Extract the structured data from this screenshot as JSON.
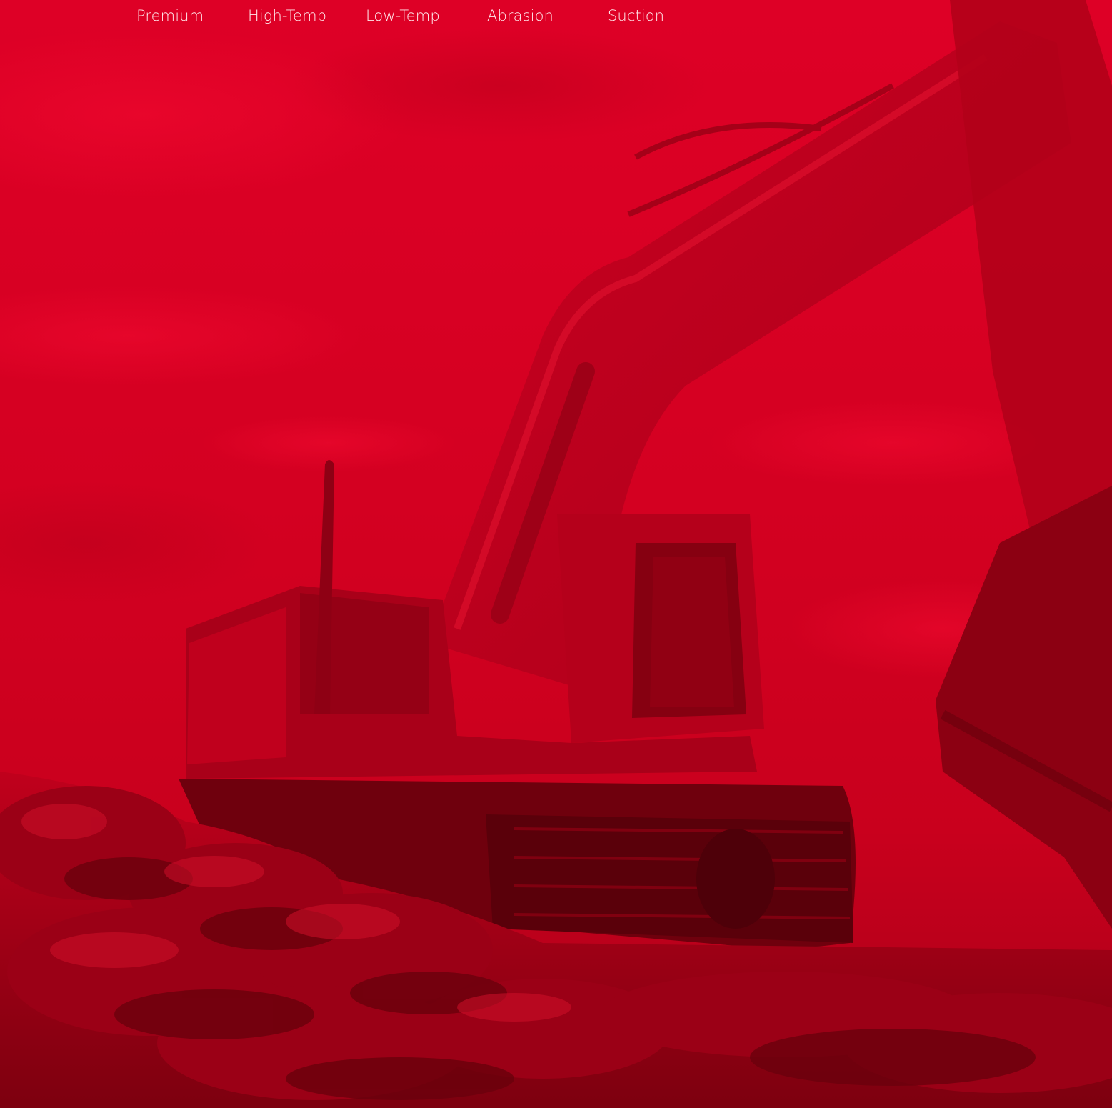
{
  "nav": {
    "tabs": [
      {
        "label": "Premium"
      },
      {
        "label": "High-Temp"
      },
      {
        "label": "Low-Temp"
      },
      {
        "label": "Abrasion"
      },
      {
        "label": "Suction"
      }
    ]
  },
  "hero": {
    "photo_subject": "excavator-on-dirt-mound",
    "tint_color": "#d30020"
  }
}
